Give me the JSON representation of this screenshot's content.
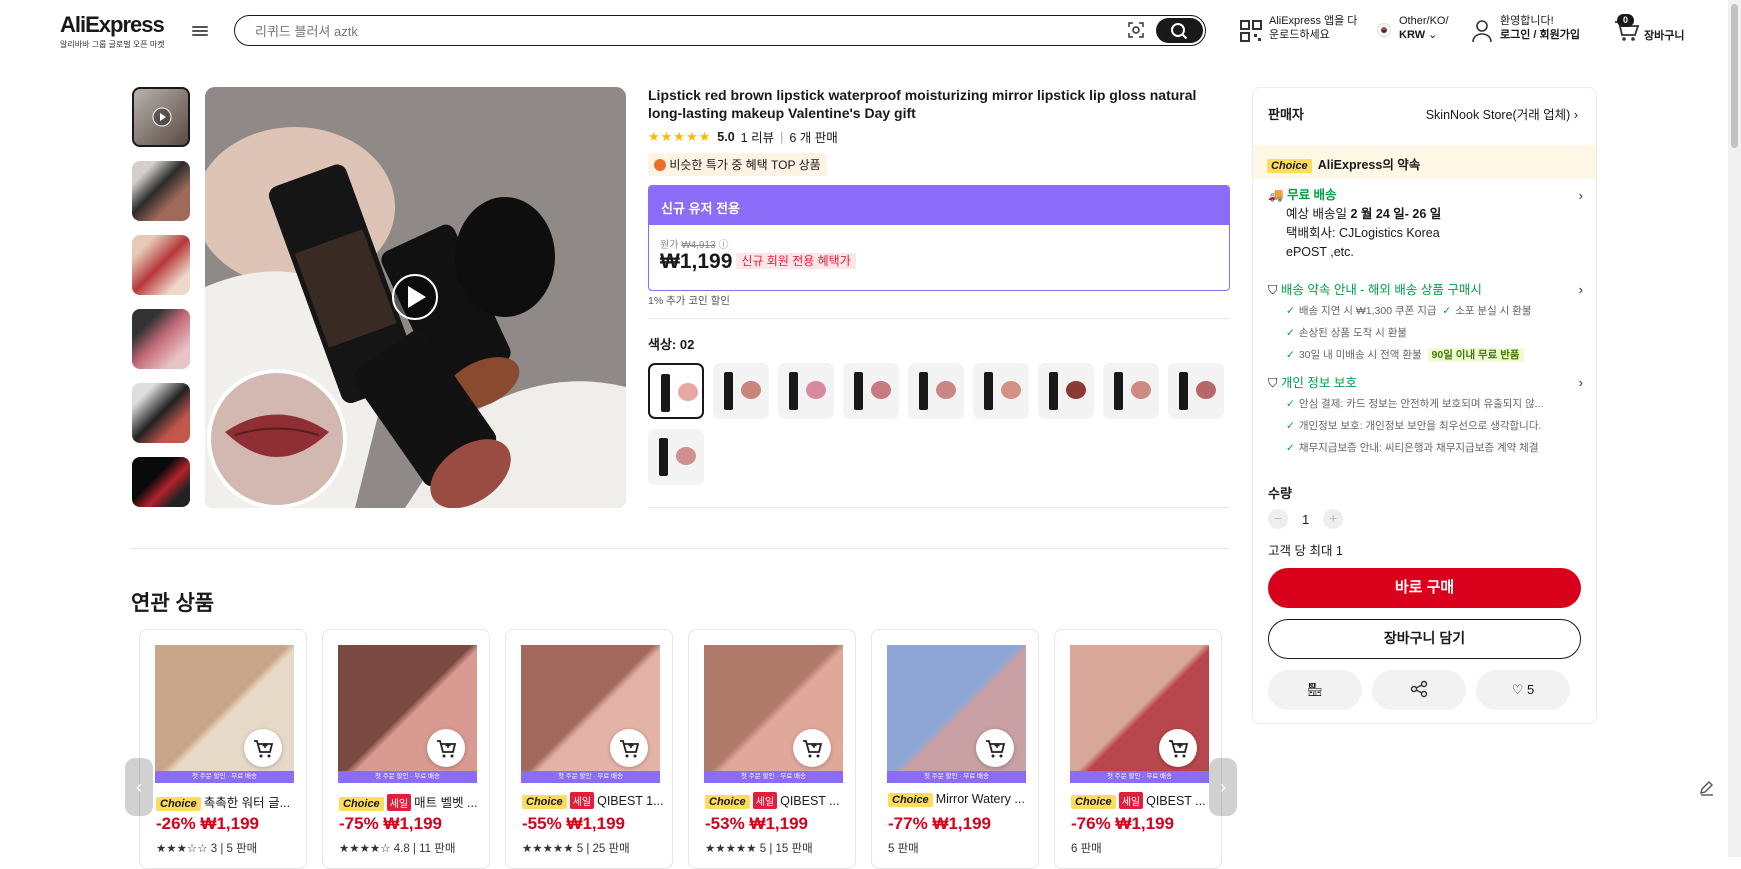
{
  "header": {
    "logo": "AliExpress",
    "logo_sub": "알리바바 그룹 글로벌 오픈 마켓",
    "search_placeholder": "리퀴드 블러셔 aztk",
    "app_line1": "AliExpress 앱을 다",
    "app_line2": "운로드하세요",
    "region_line1": "Other/KO/",
    "region_line2": "KRW",
    "login_line1": "환영합니다!",
    "login_line2": "로그인 / 회원가입",
    "cart_count": "0",
    "cart_label": "장바구니"
  },
  "product": {
    "title": "Lipstick red brown lipstick waterproof moisturizing mirror lipstick lip gloss natural long-lasting makeup Valentine's Day gift",
    "rating": "5.0",
    "reviews": "1 리뷰",
    "sold": "6 개 판매",
    "top_badge": "비슷한 특가 중 혜택 TOP 상품",
    "new_user_header": "신규 유저 전용",
    "orig_label": "원가",
    "orig_price": "₩4,913",
    "price": "₩1,199",
    "price_tag": "신규 회원 전용 혜택가",
    "coin_text": "1% 추가 코인 할인",
    "color_label": "색상: 02",
    "swatches": [
      "#e8a7a3",
      "#c9847c",
      "#d88aa0",
      "#c77a7f",
      "#c98886",
      "#d49287",
      "#8b3a36",
      "#cf8a85",
      "#b7676a",
      "#d1908d"
    ]
  },
  "panel": {
    "seller_label": "판매자",
    "seller_name": "SkinNook Store(거래 업체)",
    "choice_tag": "Choice",
    "choice_title": "AliExpress의 약속",
    "shipping_title": "무료 배송",
    "shipping_est_prefix": "예상 배송일",
    "shipping_est": "2 월 24 일- 26 일",
    "carrier_line": "택배회사:  CJLogistics  Korea",
    "carrier_line2": "ePOST ,etc.",
    "guarantee_title": "배송 약속 안내 - 해외 배송 상품 구매시",
    "g1": "배송 지연 시 ₩1,300 쿠폰 지급",
    "g2": "소포 분실 시 환불",
    "g3": "손상된 상품 도착 시 환불",
    "g4": "30일 내 미배송 시 전액 환불",
    "g4_badge": "90일 이내 무료 반품",
    "privacy_title": "개인 정보 보호",
    "p1": "안심 결제: 카드 정보는 안전하게 보호되며 유출되지 않...",
    "p2": "개인정보 보호: 개인정보 보안을 최우선으로 생각합니다.",
    "p3": "채무지급보증 안내: 씨티은행과 채무지급보증 계약 체결",
    "qty_label": "수량",
    "qty_value": "1",
    "qty_limit": "고객 당 최대 1",
    "buy_now": "바로 구매",
    "add_cart": "장바구니 담기",
    "wish_count": "5"
  },
  "related": {
    "title": "연관 상품",
    "ribbon": "첫 주문 할인 · 무료 배송",
    "items": [
      {
        "choice": "Choice",
        "sale": "",
        "name": "촉촉한 워터 글...",
        "price": "-26% ₩1,199",
        "meta": "★★★☆☆ 3 | 5 판매",
        "c1": "#c9a58a",
        "c2": "#e7d9c8"
      },
      {
        "choice": "Choice",
        "sale": "세일",
        "name": "매트 벨벳 ...",
        "price": "-75% ₩1,199",
        "meta": "★★★★☆ 4.8 | 11 판매",
        "c1": "#7a4a42",
        "c2": "#d99a92"
      },
      {
        "choice": "Choice",
        "sale": "세일",
        "name": "QIBEST 1...",
        "price": "-55% ₩1,199",
        "meta": "★★★★★ 5 | 25 판매",
        "c1": "#a2675d",
        "c2": "#e3b3a7"
      },
      {
        "choice": "Choice",
        "sale": "세일",
        "name": "QIBEST ...",
        "price": "-53% ₩1,199",
        "meta": "★★★★★ 5 | 15 판매",
        "c1": "#b07a6b",
        "c2": "#e0a89b"
      },
      {
        "choice": "Choice",
        "sale": "",
        "name": "Mirror Watery ...",
        "price": "-77% ₩1,199",
        "meta": "5 판매",
        "c1": "#8ea6d6",
        "c2": "#c9a0a3"
      },
      {
        "choice": "Choice",
        "sale": "세일",
        "name": "QIBEST ...",
        "price": "-76% ₩1,199",
        "meta": "6 판매",
        "c1": "#d9a79a",
        "c2": "#b8474d"
      }
    ]
  }
}
